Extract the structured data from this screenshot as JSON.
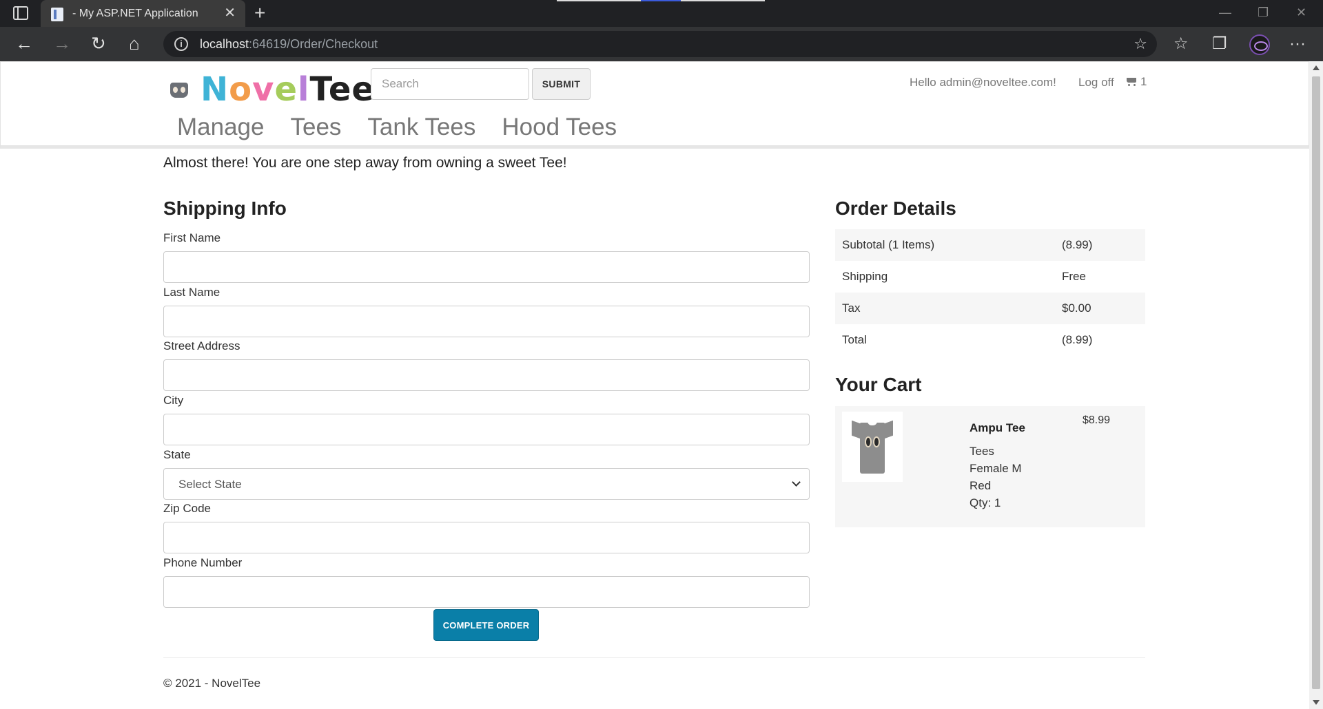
{
  "browser": {
    "tab_title": "- My ASP.NET Application",
    "tab_close": "✕",
    "new_tab": "+",
    "url_host": "localhost",
    "url_rest": ":64619/Order/Checkout",
    "back_icon": "←",
    "forward_icon": "→",
    "reload_icon": "↻",
    "home_icon": "⌂",
    "fav_add_icon": "☆",
    "favorites_icon": "☆",
    "collections_icon": "❐",
    "more_icon": "···",
    "minimize": "—",
    "restore": "❐",
    "close": "✕"
  },
  "header": {
    "logo": [
      "N",
      "o",
      "v",
      "e",
      "l",
      "Tee"
    ],
    "search_placeholder": "Search",
    "submit_label": "SUBMIT",
    "hello": "Hello admin@noveltee.com!",
    "logoff": "Log off",
    "cart_count": "1"
  },
  "nav": {
    "items": [
      "Manage",
      "Tees",
      "Tank Tees",
      "Hood Tees"
    ]
  },
  "page": {
    "tagline": "Almost there! You are one step away from owning a sweet Tee!",
    "shipping_heading": "Shipping Info",
    "order_heading": "Order Details",
    "cart_heading": "Your Cart",
    "complete_label": "COMPLETE ORDER"
  },
  "form": {
    "first_name_label": "First Name",
    "last_name_label": "Last Name",
    "street_label": "Street Address",
    "city_label": "City",
    "state_label": "State",
    "state_selected": "Select State",
    "zip_label": "Zip Code",
    "phone_label": "Phone Number"
  },
  "order": {
    "rows": [
      {
        "label": "Subtotal (1 Items)",
        "value": "(8.99)"
      },
      {
        "label": "Shipping",
        "value": "Free"
      },
      {
        "label": "Tax",
        "value": "$0.00"
      },
      {
        "label": "Total",
        "value": "(8.99)"
      }
    ]
  },
  "cart": {
    "item_name": "Ampu Tee",
    "item_price": "$8.99",
    "item_category": "Tees",
    "item_fit": "Female M",
    "item_color": "Red",
    "item_qty": "Qty: 1"
  },
  "footer": {
    "text": "© 2021 - NovelTee"
  }
}
